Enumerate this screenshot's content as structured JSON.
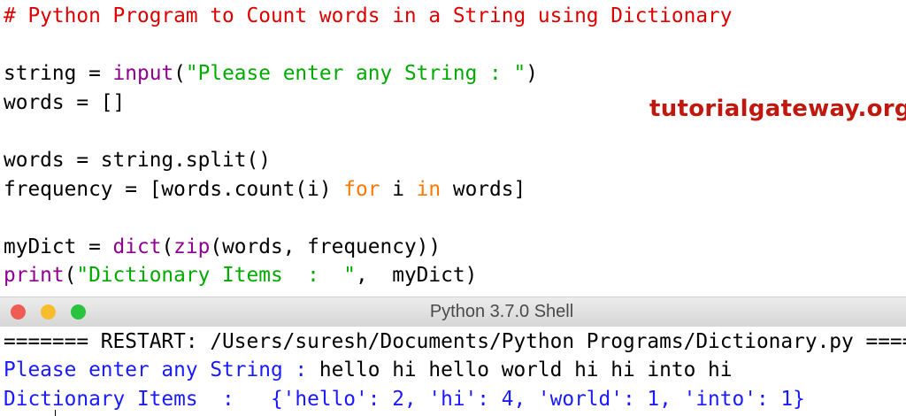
{
  "editor": {
    "lines": [
      [
        {
          "t": "# Python Program to Count words in a String using Dictionary",
          "c": "comment"
        }
      ],
      [],
      [
        {
          "t": "string = ",
          "c": "plain"
        },
        {
          "t": "input",
          "c": "builtin"
        },
        {
          "t": "(",
          "c": "plain"
        },
        {
          "t": "\"Please enter any String : \"",
          "c": "string"
        },
        {
          "t": ")",
          "c": "plain"
        }
      ],
      [
        {
          "t": "words = []",
          "c": "plain"
        }
      ],
      [],
      [
        {
          "t": "words = string.split()",
          "c": "plain"
        }
      ],
      [
        {
          "t": "frequency = [words.count(i) ",
          "c": "plain"
        },
        {
          "t": "for",
          "c": "keyword"
        },
        {
          "t": " i ",
          "c": "plain"
        },
        {
          "t": "in",
          "c": "keyword"
        },
        {
          "t": " words]",
          "c": "plain"
        }
      ],
      [],
      [
        {
          "t": "myDict = ",
          "c": "plain"
        },
        {
          "t": "dict",
          "c": "builtin"
        },
        {
          "t": "(",
          "c": "plain"
        },
        {
          "t": "zip",
          "c": "builtin"
        },
        {
          "t": "(words, frequency))",
          "c": "plain"
        }
      ],
      [
        {
          "t": "print",
          "c": "builtin"
        },
        {
          "t": "(",
          "c": "plain"
        },
        {
          "t": "\"Dictionary Items  :  \"",
          "c": "string"
        },
        {
          "t": ",  myDict)",
          "c": "plain"
        }
      ]
    ]
  },
  "watermark": "tutorialgateway.org",
  "shell": {
    "title": "Python 3.7.0 Shell",
    "traffic_lights": {
      "close": "#ee5c55",
      "minimize": "#f8bd2e",
      "zoom": "#29c33f"
    },
    "lines": [
      [
        {
          "t": "======= RESTART: /Users/suresh/Documents/Python Programs/Dictionary.py =======",
          "c": "plain"
        }
      ],
      [
        {
          "t": "Please enter any String : ",
          "c": "out"
        },
        {
          "t": "hello hi hello world hi hi into hi",
          "c": "plain"
        }
      ],
      [
        {
          "t": "Dictionary Items  :   {'hello': 2, 'hi': 4, 'world': 1, 'into': 1}",
          "c": "out"
        }
      ]
    ]
  }
}
